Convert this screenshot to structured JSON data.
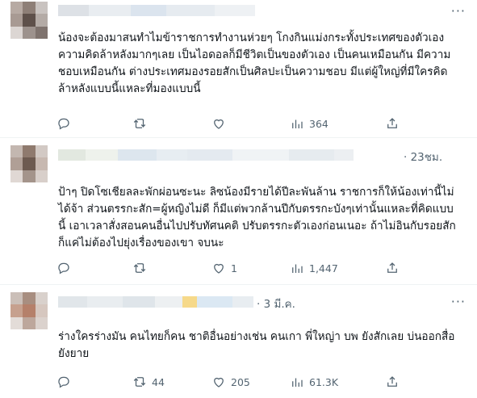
{
  "tweets": [
    {
      "time": "",
      "text": "น้องจะต้องมาสนทำไมข้าราชการทำงานห่วยๆ โกงกินแม่งกระทั้งประเทศของตัวเอง\nความคิดล้าหลังมากๆเลย เป็นไอดอลก็มีชีวิตเป็นของตัวเอง เป็นคนเหมือนกัน มีความ\nชอบเหมือนกัน ต่างประเทศมองรอยสักเป็นศิลปะเป็นความชอบ มีแต่ผู้ใหญ่ที่มีใครคิด\nล้าหลังแบบนี้แหละที่มองแบบนี้",
      "reply_count": "",
      "retweet_count": "",
      "like_count": "",
      "view_count": "364"
    },
    {
      "time": "· 23ชม.",
      "text": "ป้าๆ ปิดโซเชียลละพักผ่อนซะนะ ลิซน้องมีรายได้ปีละพันล้าน ราชการก็ให้น้องเท่านี้ไม่\nได้จ้า ส่วนตรรกะสัก=ผู้หญิงไม่ดี ก็มีแต่พวกล้านปีกับตรรกะบังๆเท่านั้นแหละที่คิดแบบ\nนี้ เอาเวลาสั่งสอนคนอื่นไปปรับทัศนคติ ปรับตรรกะตัวเองก่อนเนอะ ถ้าไม่อินกับรอยสัก\nก็แค่ไม่ต้องไปยุ่งเรื่องของเขา จบนะ",
      "reply_count": "",
      "retweet_count": "",
      "like_count": "1",
      "view_count": "1,447"
    },
    {
      "time": "· 3 มี.ค.",
      "text": "ร่างใครร่างมัน คนไทยก็คน ชาติอื่นอย่างเช่น คนเกา พี่ใหญ่า บพ ยังสักเลย บ่นออกสื่อ\nยังยาย",
      "reply_count": "",
      "retweet_count": "44",
      "like_count": "205",
      "view_count": "61.3K"
    }
  ],
  "icons": {
    "reply": "reply-icon",
    "retweet": "retweet-icon",
    "like": "like-icon",
    "views": "views-icon",
    "share": "share-icon",
    "more": "more-icon"
  },
  "more_glyph": "···"
}
